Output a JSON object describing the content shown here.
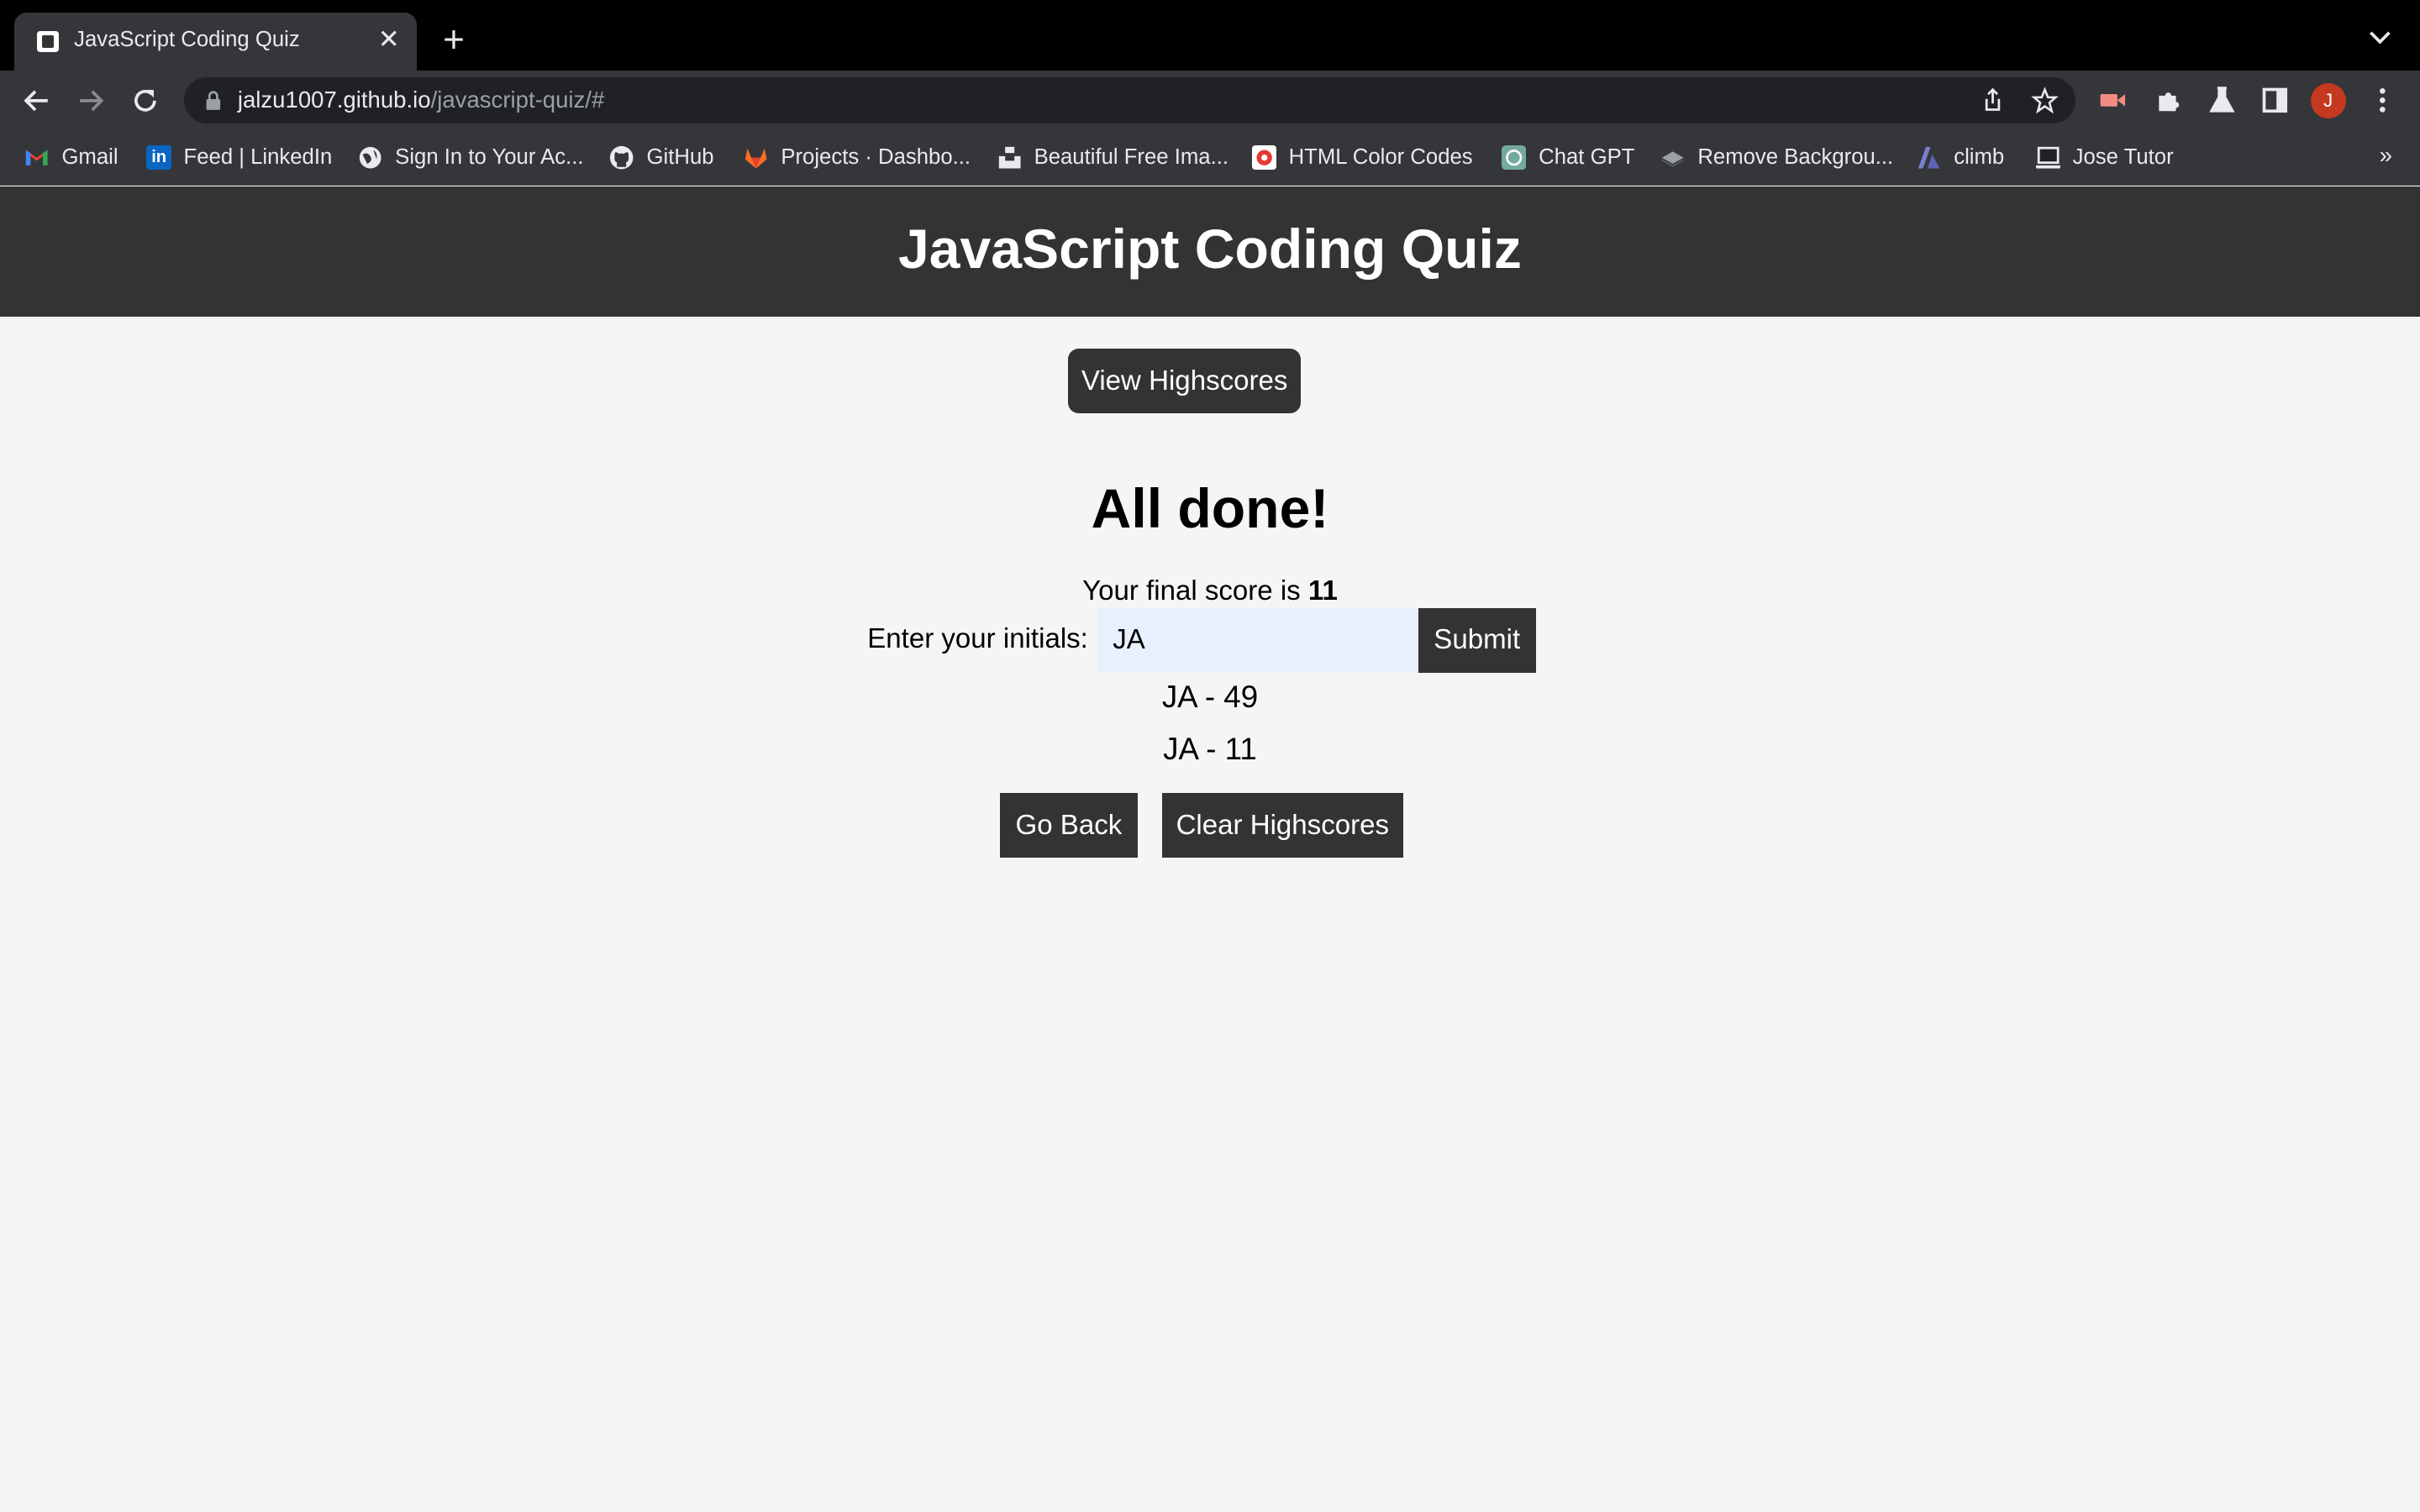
{
  "browser": {
    "tab_title": "JavaScript Coding Quiz",
    "url_host": "jalzu1007.github.io",
    "url_path": "/javascript-quiz/#",
    "avatar_initial": "J",
    "bookmarks": [
      {
        "label": "Gmail",
        "icon": "gmail-icon",
        "color": "#ea4335"
      },
      {
        "label": "Feed | LinkedIn",
        "icon": "linkedin-icon",
        "color": "#0a66c2"
      },
      {
        "label": "Sign In to Your Ac...",
        "icon": "globe-icon",
        "color": "#e8eaed"
      },
      {
        "label": "GitHub",
        "icon": "github-icon",
        "color": "#e8eaed"
      },
      {
        "label": "Projects · Dashbo...",
        "icon": "gitlab-icon",
        "color": "#e24329"
      },
      {
        "label": "Beautiful Free Ima...",
        "icon": "unsplash-icon",
        "color": "#000000"
      },
      {
        "label": "HTML Color Codes",
        "icon": "color-codes-icon",
        "color": "#e53935"
      },
      {
        "label": "Chat GPT",
        "icon": "chatgpt-icon",
        "color": "#74aa9c"
      },
      {
        "label": "Remove Backgrou...",
        "icon": "remove-bg-icon",
        "color": "#8ab4f8"
      },
      {
        "label": "climb",
        "icon": "climb-icon",
        "color": "#7b7fd4"
      },
      {
        "label": "Jose Tutor",
        "icon": "jose-tutor-icon",
        "color": "#202124"
      }
    ],
    "bookmarks_more": "»"
  },
  "page": {
    "header_title": "JavaScript Coding Quiz",
    "view_highscores_label": "View Highscores",
    "done_title": "All done!",
    "final_score_prefix": "Your final score is ",
    "final_score_value": "11",
    "initials_label": "Enter your initials:",
    "initials_value": "JA",
    "submit_label": "Submit",
    "highscores": [
      "JA - 49",
      "JA - 11"
    ],
    "go_back_label": "Go Back",
    "clear_label": "Clear Highscores"
  },
  "colors": {
    "header_bg": "#333333",
    "page_bg": "#f5f5f5",
    "input_bg": "#e8f0fe"
  }
}
